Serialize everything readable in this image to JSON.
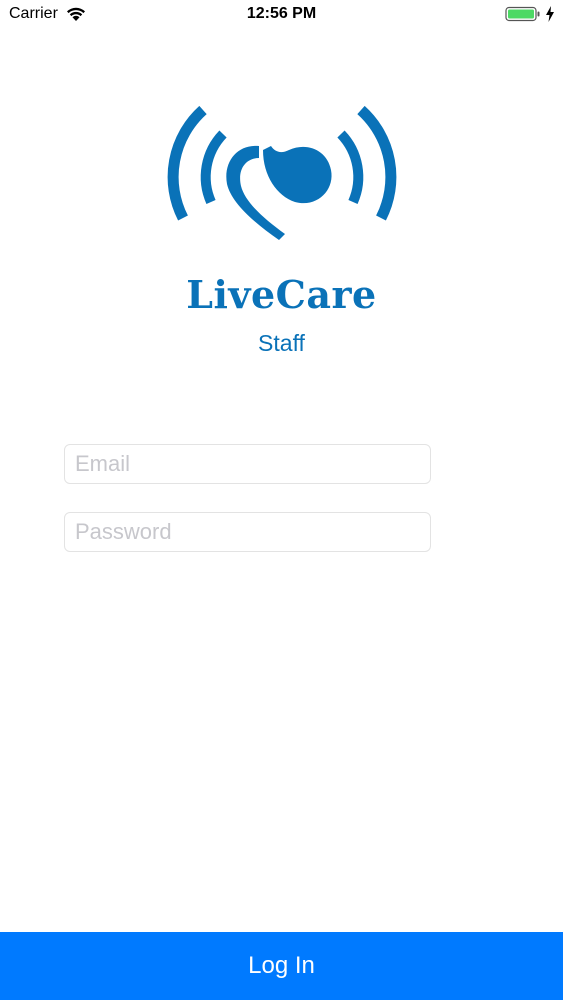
{
  "status_bar": {
    "carrier": "Carrier",
    "time": "12:56 PM",
    "icons": [
      "wifi-icon",
      "battery-icon",
      "charging-bolt-icon"
    ]
  },
  "brand": {
    "name": "LiveCare",
    "subtitle": "Staff",
    "logo": "heart-broadcast-logo",
    "color": "#0a72b8"
  },
  "form": {
    "email": {
      "placeholder": "Email",
      "value": ""
    },
    "password": {
      "placeholder": "Password",
      "value": ""
    }
  },
  "actions": {
    "login_label": "Log In",
    "login_color": "#007aff"
  }
}
